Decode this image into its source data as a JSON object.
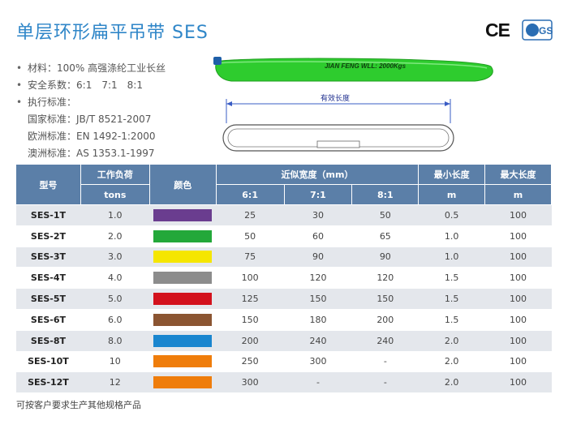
{
  "title": "单层环形扁平吊带 SES",
  "certs": {
    "ce": "CE",
    "gs": "GS"
  },
  "specs": {
    "material_label": "材料：",
    "material_value": "100% 高强涤纶工业长丝",
    "safety_label": "安全系数：",
    "safety_values": [
      "6:1",
      "7:1",
      "8:1"
    ],
    "standard_label": "执行标准：",
    "standards": [
      {
        "label": "国家标准：",
        "value": "JB/T 8521-2007"
      },
      {
        "label": "欧洲标准：",
        "value": "EN 1492-1:2000"
      },
      {
        "label": "澳洲标准：",
        "value": "AS 1353.1-1997"
      }
    ]
  },
  "sling": {
    "print": "JIAN FENG WLL: 2000Kgs",
    "length_label": "有效长度",
    "color": "#2ecc2e"
  },
  "table": {
    "headers": {
      "model": "型号",
      "wll": "工作负荷",
      "wll_unit": "tons",
      "color": "颜色",
      "width": "近似宽度（mm）",
      "ratios": [
        "6:1",
        "7:1",
        "8:1"
      ],
      "min_len": "最小长度",
      "min_unit": "m",
      "max_len": "最大长度",
      "max_unit": "m"
    },
    "rows": [
      {
        "model": "SES-1T",
        "wll": "1.0",
        "color": "#6a3d8f",
        "w6": "25",
        "w7": "30",
        "w8": "50",
        "min": "0.5",
        "max": "100"
      },
      {
        "model": "SES-2T",
        "wll": "2.0",
        "color": "#23a83a",
        "w6": "50",
        "w7": "60",
        "w8": "65",
        "min": "1.0",
        "max": "100"
      },
      {
        "model": "SES-3T",
        "wll": "3.0",
        "color": "#f5e600",
        "w6": "75",
        "w7": "90",
        "w8": "90",
        "min": "1.0",
        "max": "100"
      },
      {
        "model": "SES-4T",
        "wll": "4.0",
        "color": "#8c8c8c",
        "w6": "100",
        "w7": "120",
        "w8": "120",
        "min": "1.5",
        "max": "100"
      },
      {
        "model": "SES-5T",
        "wll": "5.0",
        "color": "#d3121d",
        "w6": "125",
        "w7": "150",
        "w8": "150",
        "min": "1.5",
        "max": "100"
      },
      {
        "model": "SES-6T",
        "wll": "6.0",
        "color": "#8b5532",
        "w6": "150",
        "w7": "180",
        "w8": "200",
        "min": "1.5",
        "max": "100"
      },
      {
        "model": "SES-8T",
        "wll": "8.0",
        "color": "#1a86cf",
        "w6": "200",
        "w7": "240",
        "w8": "240",
        "min": "2.0",
        "max": "100"
      },
      {
        "model": "SES-10T",
        "wll": "10",
        "color": "#ef7d0b",
        "w6": "250",
        "w7": "300",
        "w8": "-",
        "min": "2.0",
        "max": "100"
      },
      {
        "model": "SES-12T",
        "wll": "12",
        "color": "#ef7d0b",
        "w6": "300",
        "w7": "-",
        "w8": "-",
        "min": "2.0",
        "max": "100"
      }
    ]
  },
  "footnote": "可按客户要求生产其他规格产品"
}
